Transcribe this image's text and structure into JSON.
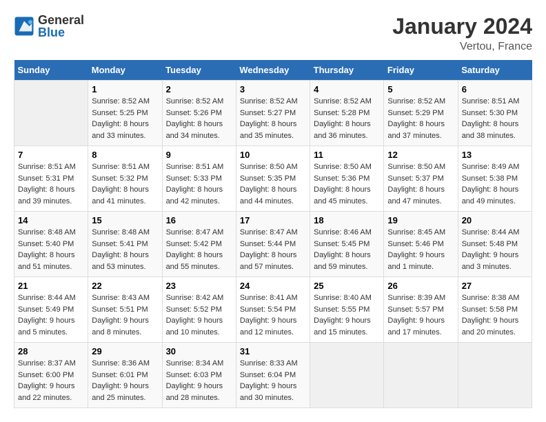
{
  "logo": {
    "general": "General",
    "blue": "Blue"
  },
  "title": "January 2024",
  "subtitle": "Vertou, France",
  "days_header": [
    "Sunday",
    "Monday",
    "Tuesday",
    "Wednesday",
    "Thursday",
    "Friday",
    "Saturday"
  ],
  "weeks": [
    [
      {
        "num": "",
        "info": ""
      },
      {
        "num": "1",
        "info": "Sunrise: 8:52 AM\nSunset: 5:25 PM\nDaylight: 8 hours\nand 33 minutes."
      },
      {
        "num": "2",
        "info": "Sunrise: 8:52 AM\nSunset: 5:26 PM\nDaylight: 8 hours\nand 34 minutes."
      },
      {
        "num": "3",
        "info": "Sunrise: 8:52 AM\nSunset: 5:27 PM\nDaylight: 8 hours\nand 35 minutes."
      },
      {
        "num": "4",
        "info": "Sunrise: 8:52 AM\nSunset: 5:28 PM\nDaylight: 8 hours\nand 36 minutes."
      },
      {
        "num": "5",
        "info": "Sunrise: 8:52 AM\nSunset: 5:29 PM\nDaylight: 8 hours\nand 37 minutes."
      },
      {
        "num": "6",
        "info": "Sunrise: 8:51 AM\nSunset: 5:30 PM\nDaylight: 8 hours\nand 38 minutes."
      }
    ],
    [
      {
        "num": "7",
        "info": "Sunrise: 8:51 AM\nSunset: 5:31 PM\nDaylight: 8 hours\nand 39 minutes."
      },
      {
        "num": "8",
        "info": "Sunrise: 8:51 AM\nSunset: 5:32 PM\nDaylight: 8 hours\nand 41 minutes."
      },
      {
        "num": "9",
        "info": "Sunrise: 8:51 AM\nSunset: 5:33 PM\nDaylight: 8 hours\nand 42 minutes."
      },
      {
        "num": "10",
        "info": "Sunrise: 8:50 AM\nSunset: 5:35 PM\nDaylight: 8 hours\nand 44 minutes."
      },
      {
        "num": "11",
        "info": "Sunrise: 8:50 AM\nSunset: 5:36 PM\nDaylight: 8 hours\nand 45 minutes."
      },
      {
        "num": "12",
        "info": "Sunrise: 8:50 AM\nSunset: 5:37 PM\nDaylight: 8 hours\nand 47 minutes."
      },
      {
        "num": "13",
        "info": "Sunrise: 8:49 AM\nSunset: 5:38 PM\nDaylight: 8 hours\nand 49 minutes."
      }
    ],
    [
      {
        "num": "14",
        "info": "Sunrise: 8:48 AM\nSunset: 5:40 PM\nDaylight: 8 hours\nand 51 minutes."
      },
      {
        "num": "15",
        "info": "Sunrise: 8:48 AM\nSunset: 5:41 PM\nDaylight: 8 hours\nand 53 minutes."
      },
      {
        "num": "16",
        "info": "Sunrise: 8:47 AM\nSunset: 5:42 PM\nDaylight: 8 hours\nand 55 minutes."
      },
      {
        "num": "17",
        "info": "Sunrise: 8:47 AM\nSunset: 5:44 PM\nDaylight: 8 hours\nand 57 minutes."
      },
      {
        "num": "18",
        "info": "Sunrise: 8:46 AM\nSunset: 5:45 PM\nDaylight: 8 hours\nand 59 minutes."
      },
      {
        "num": "19",
        "info": "Sunrise: 8:45 AM\nSunset: 5:46 PM\nDaylight: 9 hours\nand 1 minute."
      },
      {
        "num": "20",
        "info": "Sunrise: 8:44 AM\nSunset: 5:48 PM\nDaylight: 9 hours\nand 3 minutes."
      }
    ],
    [
      {
        "num": "21",
        "info": "Sunrise: 8:44 AM\nSunset: 5:49 PM\nDaylight: 9 hours\nand 5 minutes."
      },
      {
        "num": "22",
        "info": "Sunrise: 8:43 AM\nSunset: 5:51 PM\nDaylight: 9 hours\nand 8 minutes."
      },
      {
        "num": "23",
        "info": "Sunrise: 8:42 AM\nSunset: 5:52 PM\nDaylight: 9 hours\nand 10 minutes."
      },
      {
        "num": "24",
        "info": "Sunrise: 8:41 AM\nSunset: 5:54 PM\nDaylight: 9 hours\nand 12 minutes."
      },
      {
        "num": "25",
        "info": "Sunrise: 8:40 AM\nSunset: 5:55 PM\nDaylight: 9 hours\nand 15 minutes."
      },
      {
        "num": "26",
        "info": "Sunrise: 8:39 AM\nSunset: 5:57 PM\nDaylight: 9 hours\nand 17 minutes."
      },
      {
        "num": "27",
        "info": "Sunrise: 8:38 AM\nSunset: 5:58 PM\nDaylight: 9 hours\nand 20 minutes."
      }
    ],
    [
      {
        "num": "28",
        "info": "Sunrise: 8:37 AM\nSunset: 6:00 PM\nDaylight: 9 hours\nand 22 minutes."
      },
      {
        "num": "29",
        "info": "Sunrise: 8:36 AM\nSunset: 6:01 PM\nDaylight: 9 hours\nand 25 minutes."
      },
      {
        "num": "30",
        "info": "Sunrise: 8:34 AM\nSunset: 6:03 PM\nDaylight: 9 hours\nand 28 minutes."
      },
      {
        "num": "31",
        "info": "Sunrise: 8:33 AM\nSunset: 6:04 PM\nDaylight: 9 hours\nand 30 minutes."
      },
      {
        "num": "",
        "info": ""
      },
      {
        "num": "",
        "info": ""
      },
      {
        "num": "",
        "info": ""
      }
    ]
  ]
}
